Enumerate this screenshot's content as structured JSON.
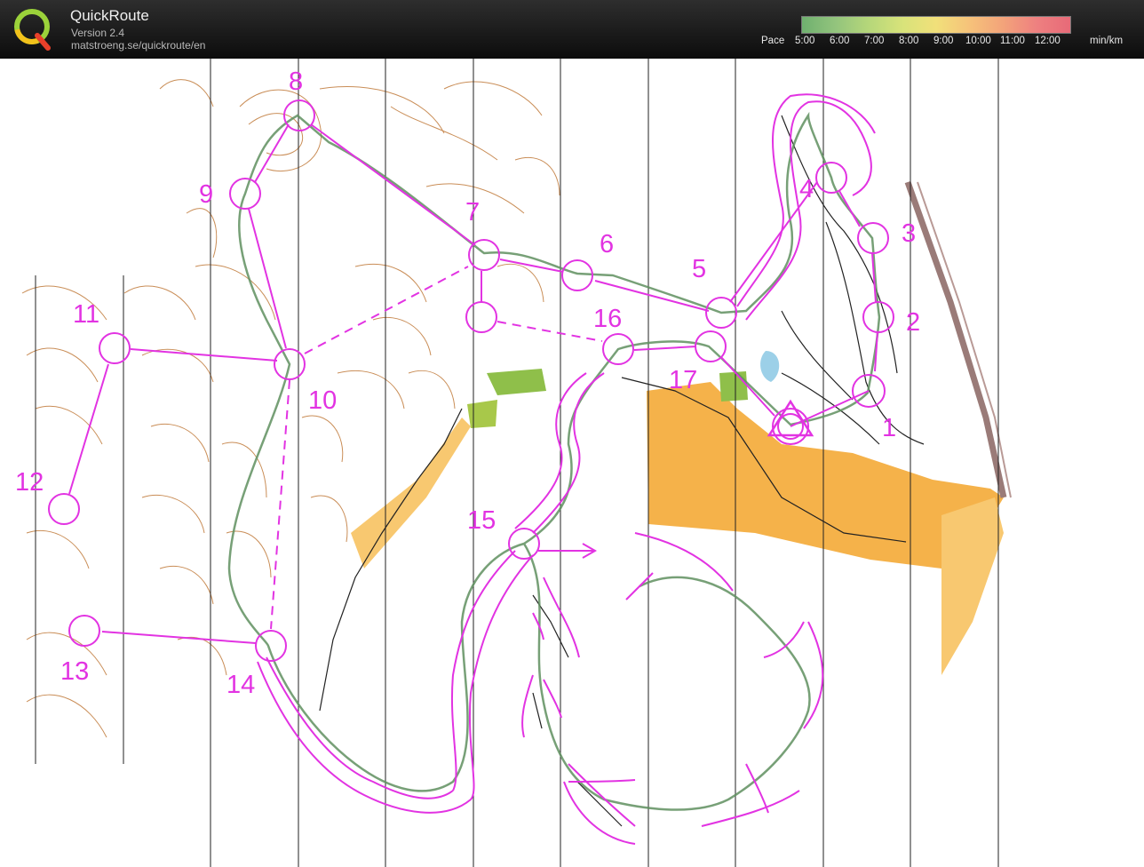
{
  "app": {
    "title": "QuickRoute",
    "version": "Version 2.4",
    "url": "matstroeng.se/quickroute/en"
  },
  "pace_legend": {
    "label": "Pace",
    "ticks": [
      "5:00",
      "6:00",
      "7:00",
      "8:00",
      "9:00",
      "10:00",
      "11:00",
      "12:00"
    ],
    "unit": "min/km"
  },
  "colors": {
    "course": "#e233e2",
    "route": "#5f8f5f",
    "contour": "#c07a3a",
    "open_land": "#f5b24a",
    "meridian": "#222222"
  },
  "icons": {
    "logo": "quickroute-logo"
  },
  "course": {
    "controls": [
      {
        "id": "1",
        "label": "1"
      },
      {
        "id": "2",
        "label": "2"
      },
      {
        "id": "3",
        "label": "3"
      },
      {
        "id": "4",
        "label": "4"
      },
      {
        "id": "5",
        "label": "5"
      },
      {
        "id": "6",
        "label": "6"
      },
      {
        "id": "7",
        "label": "7"
      },
      {
        "id": "8",
        "label": "8"
      },
      {
        "id": "9",
        "label": "9"
      },
      {
        "id": "10",
        "label": "10"
      },
      {
        "id": "11",
        "label": "11"
      },
      {
        "id": "12",
        "label": "12"
      },
      {
        "id": "13",
        "label": "13"
      },
      {
        "id": "14",
        "label": "14"
      },
      {
        "id": "15",
        "label": "15"
      },
      {
        "id": "16",
        "label": "16"
      },
      {
        "id": "17",
        "label": "17"
      }
    ]
  }
}
